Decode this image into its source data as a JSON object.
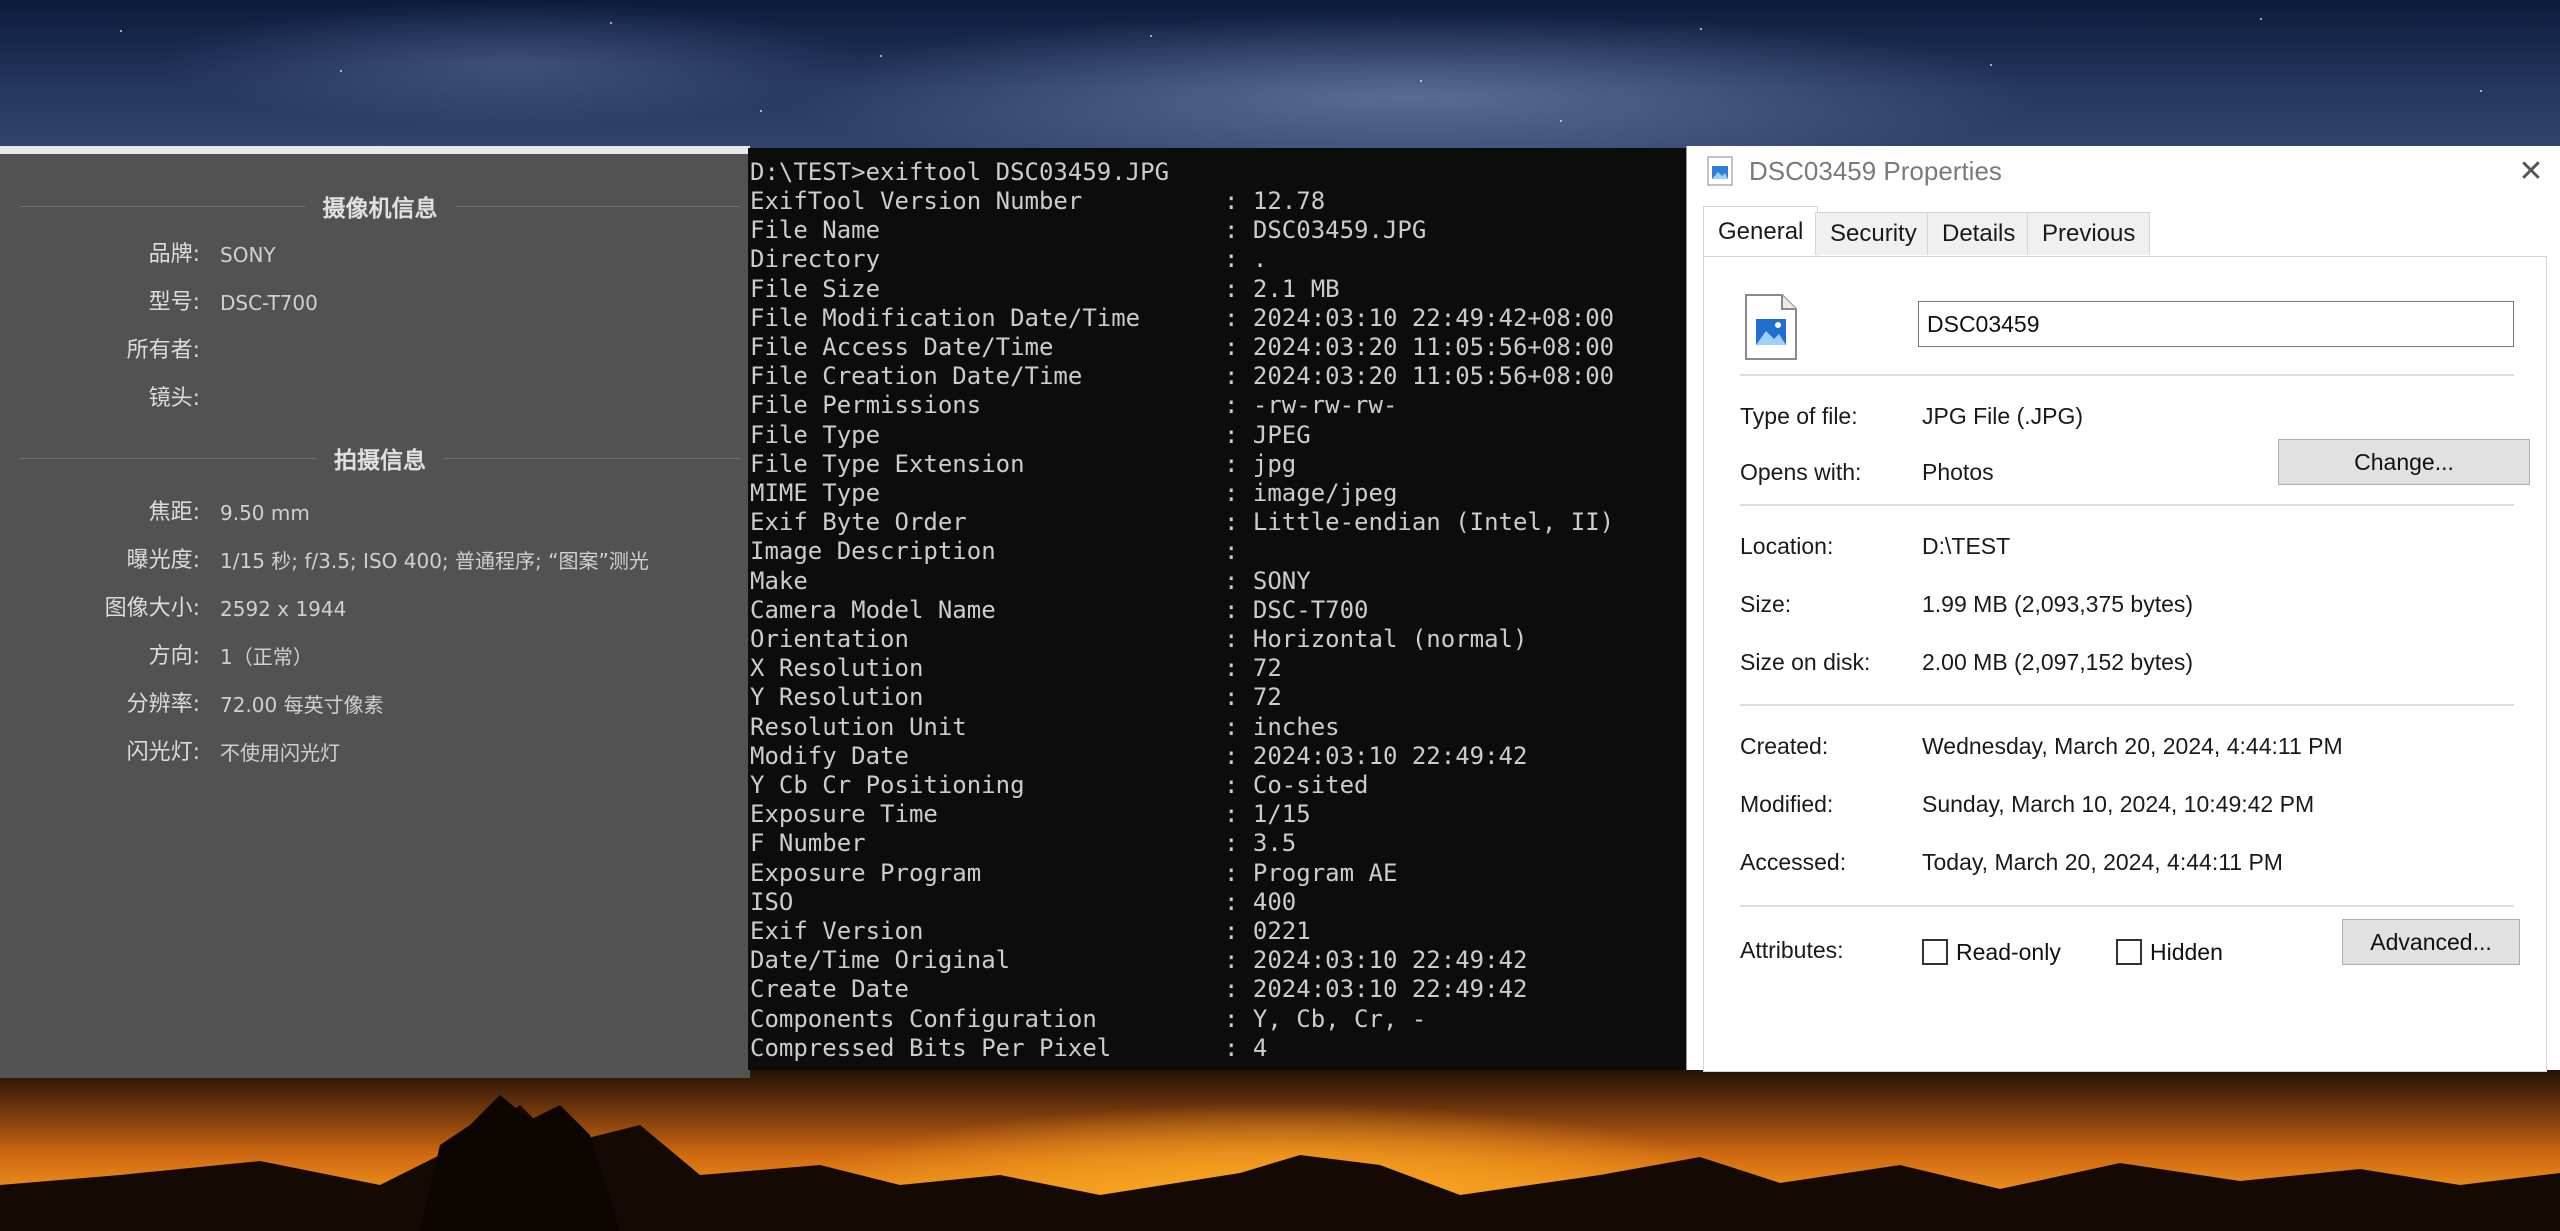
{
  "camera_info": {
    "section_title": "摄像机信息",
    "rows": [
      {
        "label": "品牌:",
        "value": "SONY"
      },
      {
        "label": "型号:",
        "value": "DSC-T700"
      },
      {
        "label": "所有者:",
        "value": ""
      },
      {
        "label": "镜头:",
        "value": ""
      }
    ]
  },
  "shooting_info": {
    "section_title": "拍摄信息",
    "rows": [
      {
        "label": "焦距:",
        "value": "9.50 mm"
      },
      {
        "label": "曝光度:",
        "value": "1/15 秒;  f/3.5;  ISO 400;  普通程序;  “图案”测光"
      },
      {
        "label": "图像大小:",
        "value": "2592 x 1944"
      },
      {
        "label": "方向:",
        "value": "1（正常）"
      },
      {
        "label": "分辨率:",
        "value": "72.00 每英寸像素"
      },
      {
        "label": "闪光灯:",
        "value": "不使用闪光灯"
      }
    ]
  },
  "terminal": {
    "command": "D:\\TEST>exiftool DSC03459.JPG",
    "rows": [
      {
        "key": "ExifTool Version Number",
        "value": ": 12.78"
      },
      {
        "key": "File Name",
        "value": ": DSC03459.JPG"
      },
      {
        "key": "Directory",
        "value": ": ."
      },
      {
        "key": "File Size",
        "value": ": 2.1 MB"
      },
      {
        "key": "File Modification Date/Time",
        "value": ": 2024:03:10 22:49:42+08:00"
      },
      {
        "key": "File Access Date/Time",
        "value": ": 2024:03:20 11:05:56+08:00"
      },
      {
        "key": "File Creation Date/Time",
        "value": ": 2024:03:20 11:05:56+08:00"
      },
      {
        "key": "File Permissions",
        "value": ": -rw-rw-rw-"
      },
      {
        "key": "File Type",
        "value": ": JPEG"
      },
      {
        "key": "File Type Extension",
        "value": ": jpg"
      },
      {
        "key": "MIME Type",
        "value": ": image/jpeg"
      },
      {
        "key": "Exif Byte Order",
        "value": ": Little-endian (Intel, II)"
      },
      {
        "key": "Image Description",
        "value": ":"
      },
      {
        "key": "Make",
        "value": ": SONY"
      },
      {
        "key": "Camera Model Name",
        "value": ": DSC-T700"
      },
      {
        "key": "Orientation",
        "value": ": Horizontal (normal)"
      },
      {
        "key": "X Resolution",
        "value": ": 72"
      },
      {
        "key": "Y Resolution",
        "value": ": 72"
      },
      {
        "key": "Resolution Unit",
        "value": ": inches"
      },
      {
        "key": "Modify Date",
        "value": ": 2024:03:10 22:49:42"
      },
      {
        "key": "Y Cb Cr Positioning",
        "value": ": Co-sited"
      },
      {
        "key": "Exposure Time",
        "value": ": 1/15"
      },
      {
        "key": "F Number",
        "value": ": 3.5"
      },
      {
        "key": "Exposure Program",
        "value": ": Program AE"
      },
      {
        "key": "ISO",
        "value": ": 400"
      },
      {
        "key": "Exif Version",
        "value": ": 0221"
      },
      {
        "key": "Date/Time Original",
        "value": ": 2024:03:10 22:49:42"
      },
      {
        "key": "Create Date",
        "value": ": 2024:03:10 22:49:42"
      },
      {
        "key": "Components Configuration",
        "value": ": Y, Cb, Cr, -"
      },
      {
        "key": "Compressed Bits Per Pixel",
        "value": ": 4"
      }
    ]
  },
  "properties": {
    "title": "DSC03459 Properties",
    "close_glyph": "✕",
    "tabs": [
      "General",
      "Security",
      "Details",
      "Previous Versions"
    ],
    "active_tab": "General",
    "file_name": "DSC03459",
    "type_label": "Type of file:",
    "type_value": "JPG File (.JPG)",
    "opens_label": "Opens with:",
    "opens_value": "Photos",
    "change_button": "Change...",
    "location_label": "Location:",
    "location_value": "D:\\TEST",
    "size_label": "Size:",
    "size_value": "1.99 MB (2,093,375 bytes)",
    "size_disk_label": "Size on disk:",
    "size_disk_value": "2.00 MB (2,097,152 bytes)",
    "created_label": "Created:",
    "created_value": "Wednesday, March 20, 2024, 4:44:11 PM",
    "modified_label": "Modified:",
    "modified_value": "Sunday, March 10, 2024, 10:49:42 PM",
    "accessed_label": "Accessed:",
    "accessed_value": "Today, March 20, 2024, 4:44:11 PM",
    "attributes_label": "Attributes:",
    "readonly_label": "Read-only",
    "readonly_checked": false,
    "hidden_label": "Hidden",
    "hidden_checked": false,
    "advanced_button": "Advanced..."
  }
}
